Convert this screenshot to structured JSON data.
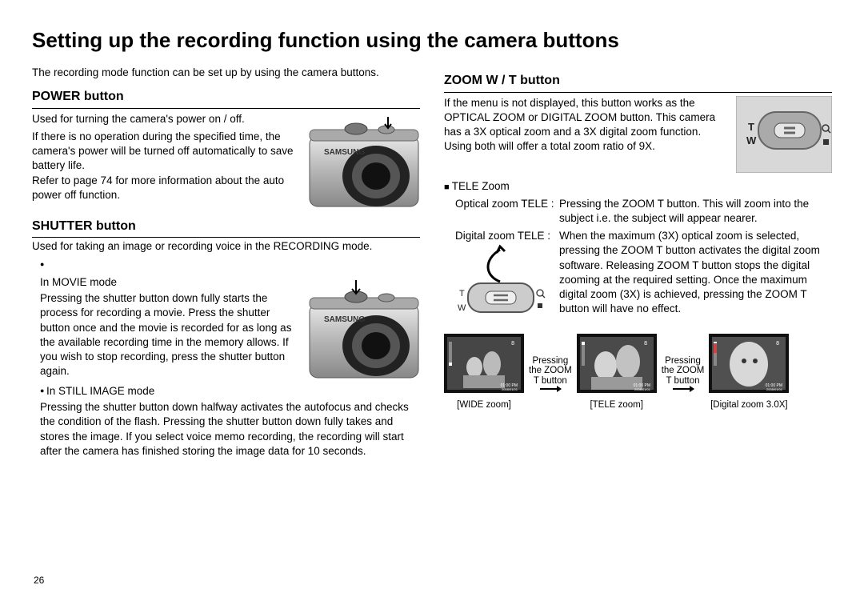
{
  "pageNumber": "26",
  "title": "Setting up the recording function using the camera buttons",
  "intro": "The recording mode function can be set up by using the camera buttons.",
  "power": {
    "heading": "POWER button",
    "line1": "Used for turning the camera's power on / off.",
    "line2": "If there is no operation during the specified time, the camera's power will be turned off automatically to save battery life.",
    "line3": "Refer to page 74 for more information about the auto power off function."
  },
  "shutter": {
    "heading": "SHUTTER button",
    "intro": "Used for taking an image or recording voice in the RECORDING mode.",
    "movieLabel": "In MOVIE mode",
    "movieText": "Pressing the shutter button down fully starts the process for recording a movie. Press the shutter button once and the movie is recorded for as long as the available recording time in the memory allows. If you wish to stop recording, press the shutter button again.",
    "stillLabel": "In STILL IMAGE mode",
    "stillText": "Pressing the shutter button down halfway activates the autofocus and checks the condition of the flash. Pressing the shutter button down fully takes and stores the image. If you select voice memo recording, the recording will start after the camera has finished storing the image data for 10 seconds."
  },
  "zoom": {
    "heading": "ZOOM W / T button",
    "p1": "If the menu is not displayed, this button works as the OPTICAL ZOOM or DIGITAL ZOOM button. This camera has a 3X optical zoom and a 3X digital zoom function.",
    "p2": "Using both will offer a total zoom ratio of 9X.",
    "teleHeading": "TELE Zoom",
    "opticalLabel": "Optical zoom TELE :",
    "opticalText": "Pressing the ZOOM T button. This will zoom into the subject i.e. the subject will appear nearer.",
    "digitalLabel": "Digital zoom TELE  :",
    "digitalText": "When the maximum (3X) optical zoom is selected, pressing the ZOOM T button activates the digital zoom software. Releasing ZOOM T button stops the digital zooming at the required setting. Once the maximum digital zoom (3X) is achieved, pressing the ZOOM T button will have no effect.",
    "arrowLabel1": "Pressing",
    "arrowLabel2": "the ZOOM",
    "arrowLabel3": "T button",
    "lcd1": "[WIDE zoom]",
    "lcd2": "[TELE zoom]",
    "lcd3": "[Digital zoom 3.0X]",
    "tLabel": "T",
    "wLabel": "W"
  },
  "cameraBrand": "SAMSUNG"
}
